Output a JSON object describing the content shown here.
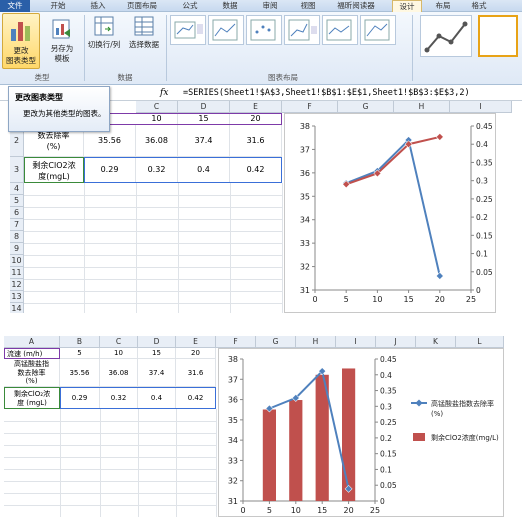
{
  "ribbon": {
    "tabs": [
      {
        "label": "文件"
      },
      {
        "label": "开始"
      },
      {
        "label": "插入"
      },
      {
        "label": "页面布局"
      },
      {
        "label": "公式"
      },
      {
        "label": "数据"
      },
      {
        "label": "审阅"
      },
      {
        "label": "视图"
      },
      {
        "label": "福昕阅读器"
      },
      {
        "label": "设计"
      },
      {
        "label": "布局"
      },
      {
        "label": "格式"
      }
    ],
    "buttons": {
      "change_type": "更改\n图表类型",
      "save_template": "另存为\n模板",
      "switch_row_col": "切换行/列",
      "select_data": "选择数据"
    },
    "groups": {
      "type": "类型",
      "data": "数据",
      "layout": "图表布局"
    }
  },
  "tooltip": {
    "title": "更改图表类型",
    "body": "更改为其他类型的图表。"
  },
  "formula": {
    "fx": "fx",
    "text": "=SERIES(Sheet1!$A$3,Sheet1!$B$1:$E$1,Sheet1!$B$3:$E$3,2)"
  },
  "sheet1": {
    "cols": [
      "C",
      "D",
      "E",
      "F",
      "G",
      "H",
      "I"
    ],
    "rows": [
      "2",
      "3",
      "4",
      "5",
      "6",
      "7",
      "8",
      "9",
      "10",
      "11",
      "12",
      "13",
      "14"
    ],
    "row1_values": [
      "10",
      "15",
      "20"
    ],
    "row2": {
      "label": "数去除率\n(%)",
      "values": [
        "35.56",
        "36.08",
        "37.4",
        "31.6"
      ]
    },
    "row3": {
      "label": "剩余ClO2浓\n度(mgL)",
      "values": [
        "0.29",
        "0.32",
        "0.4",
        "0.42"
      ]
    }
  },
  "sheet2": {
    "cols": [
      "A",
      "B",
      "C",
      "D",
      "E",
      "F",
      "G",
      "H",
      "I",
      "J",
      "K",
      "L"
    ],
    "row1": {
      "label": "流速 (m/h)",
      "values": [
        "5",
        "10",
        "15",
        "20"
      ]
    },
    "row2": {
      "label": "高锰酸盐指\n数去除率\n(%)",
      "values": [
        "35.56",
        "36.08",
        "37.4",
        "31.6"
      ]
    },
    "row3": {
      "label": "剩余ClO₂浓\n度 (mgL)",
      "values": [
        "0.29",
        "0.32",
        "0.4",
        "0.42"
      ]
    }
  },
  "chart_data": [
    {
      "type": "line",
      "x": [
        5,
        10,
        15,
        20
      ],
      "series": [
        {
          "values": [
            35.56,
            36.08,
            37.4,
            31.6
          ],
          "color": "#4f81bd",
          "axis": "left"
        },
        {
          "values": [
            0.29,
            0.32,
            0.4,
            0.42
          ],
          "color": "#c0504d",
          "axis": "right"
        }
      ],
      "xlim": [
        0,
        25
      ],
      "xticks": [
        "0",
        "5",
        "10",
        "15",
        "20",
        "25"
      ],
      "ylim_left": [
        31,
        38
      ],
      "yticks_left": [
        "31",
        "32",
        "33",
        "34",
        "35",
        "36",
        "37",
        "38"
      ],
      "ylim_right": [
        0,
        0.45
      ],
      "yticks_right": [
        "0",
        "0.05",
        "0.1",
        "0.15",
        "0.2",
        "0.25",
        "0.3",
        "0.35",
        "0.4",
        "0.45"
      ]
    },
    {
      "type": "bar",
      "x": [
        5,
        10,
        15,
        20
      ],
      "series": [
        {
          "name": "高锰酸盐指数去除率\n(%)",
          "values": [
            35.56,
            36.08,
            37.4,
            31.6
          ],
          "color": "#4f81bd",
          "axis": "left",
          "style": "line"
        },
        {
          "name": "剩余ClO2浓度(mg/L)",
          "values": [
            0.29,
            0.32,
            0.4,
            0.42
          ],
          "color": "#c0504d",
          "axis": "right",
          "style": "bar"
        }
      ],
      "xlim": [
        0,
        25
      ],
      "xticks": [
        "0",
        "5",
        "10",
        "15",
        "20",
        "25"
      ],
      "ylim_left": [
        31,
        38
      ],
      "yticks_left": [
        "31",
        "32",
        "33",
        "34",
        "35",
        "36",
        "37",
        "38"
      ],
      "ylim_right": [
        0,
        0.45
      ],
      "yticks_right": [
        "0",
        "0.05",
        "0.1",
        "0.15",
        "0.2",
        "0.25",
        "0.3",
        "0.35",
        "0.4",
        "0.45"
      ],
      "legend": "right"
    }
  ]
}
